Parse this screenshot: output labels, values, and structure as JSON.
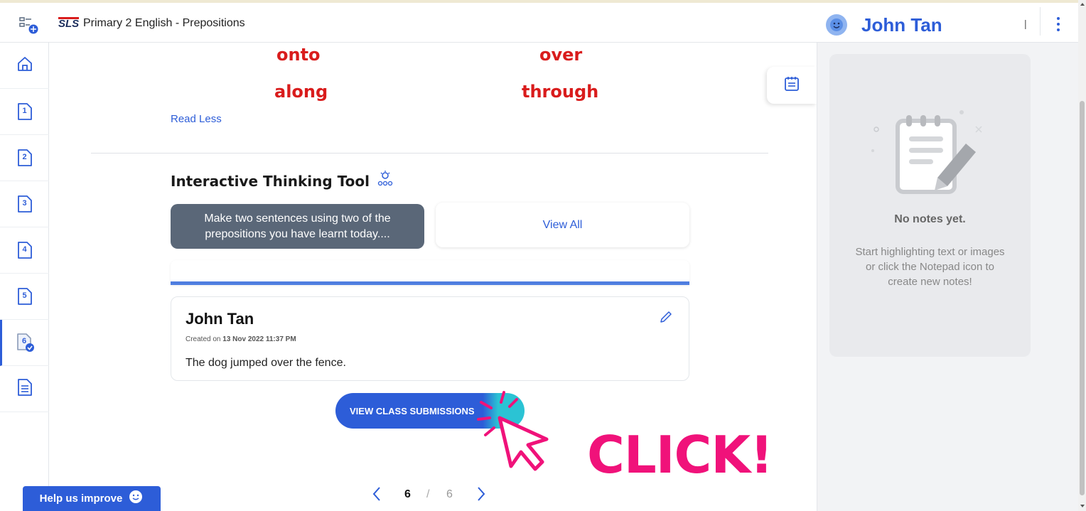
{
  "header": {
    "logo": "SLS",
    "title": "Primary 2 English - Prepositions",
    "user_name": "John Tan",
    "divider": "|"
  },
  "sidebar": {
    "items": [
      {
        "name": "home",
        "icon": "home-icon",
        "label": ""
      },
      {
        "name": "page-1",
        "icon": "page-icon",
        "label": "1"
      },
      {
        "name": "page-2",
        "icon": "page-icon",
        "label": "2"
      },
      {
        "name": "page-3",
        "icon": "page-icon",
        "label": "3"
      },
      {
        "name": "page-4",
        "icon": "page-icon",
        "label": "4"
      },
      {
        "name": "page-5",
        "icon": "page-icon",
        "label": "5"
      },
      {
        "name": "page-6",
        "icon": "page-check-icon",
        "label": "6"
      },
      {
        "name": "notes",
        "icon": "document-icon",
        "label": ""
      }
    ]
  },
  "main": {
    "words": [
      "onto",
      "over",
      "along",
      "through"
    ],
    "read_less": "Read Less",
    "section_title": "Interactive Thinking Tool",
    "prompt": "Make two sentences using two of the prepositions you have learnt today....",
    "view_all": "View All",
    "response": {
      "author": "John Tan",
      "created_prefix": "Created on",
      "created_date": "13 Nov 2022 11:37 PM",
      "text": "The dog jumped over the fence."
    },
    "view_class_button": "VIEW CLASS SUBMISSIONS",
    "callout": "CLICK!"
  },
  "pager": {
    "current": "6",
    "separator": "/",
    "total": "6"
  },
  "notes": {
    "title": "No notes yet.",
    "message": "Start highlighting text or images or click the Notepad icon to create new notes!"
  },
  "feedback": {
    "label": "Help us improve"
  },
  "colors": {
    "accent": "#2d5dd8",
    "word_red": "#d91c1c",
    "prompt_bg": "#5a6778",
    "click_pink": "#f0127a",
    "teal": "#2bc3d4"
  }
}
